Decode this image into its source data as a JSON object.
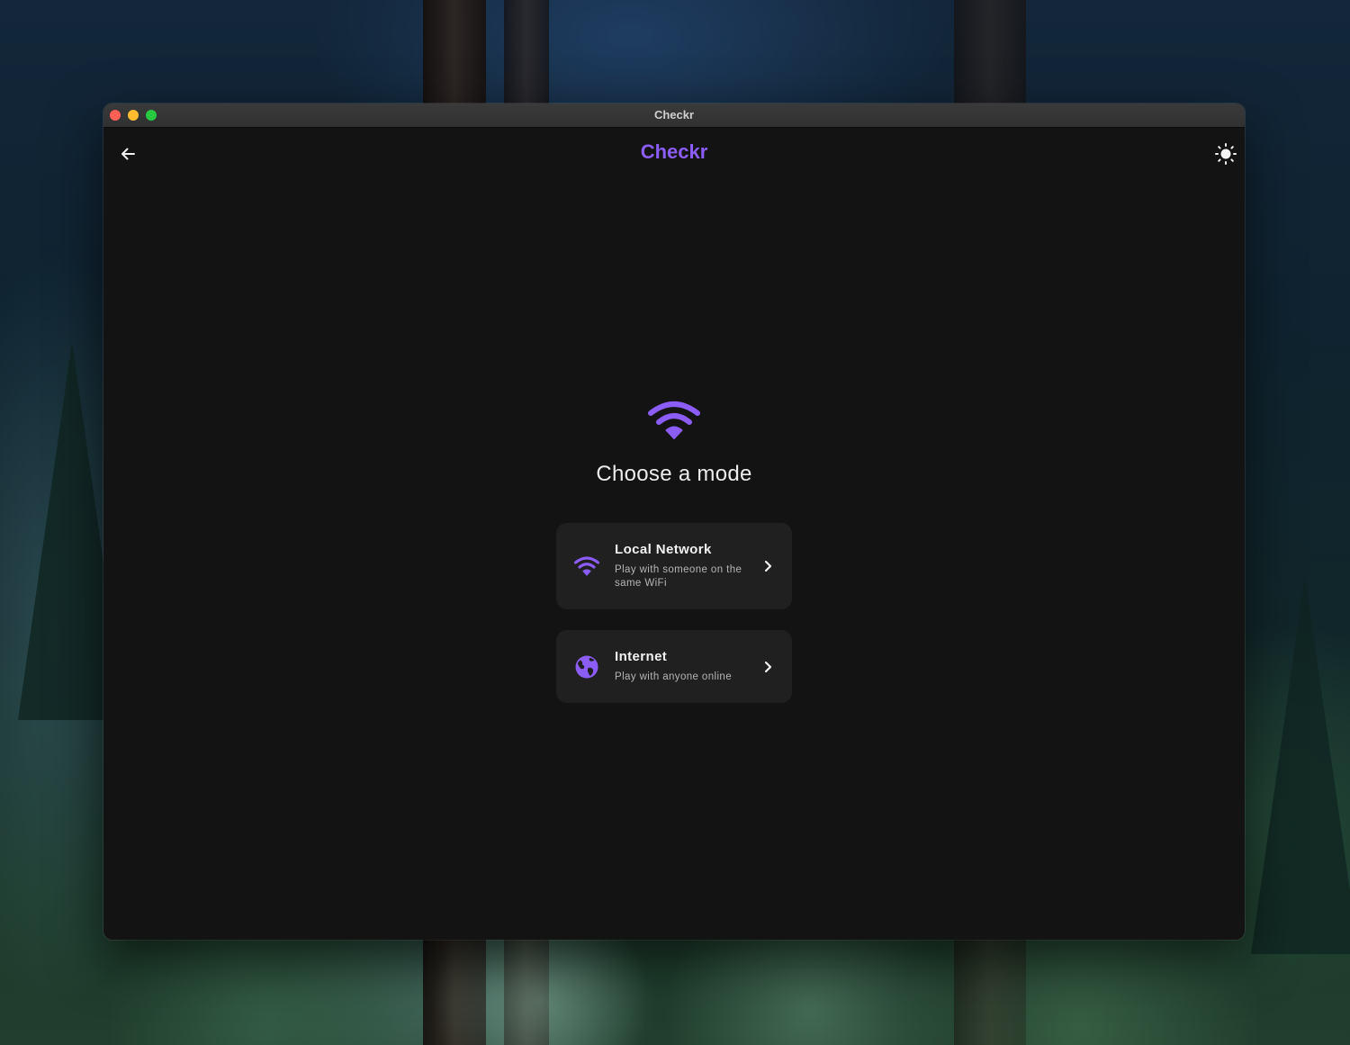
{
  "window": {
    "title": "Checkr"
  },
  "appbar": {
    "title": "Checkr",
    "back_icon": "arrow-left-icon",
    "theme_icon": "sun-icon"
  },
  "main": {
    "hero_icon": "wifi-icon",
    "heading": "Choose a mode",
    "options": [
      {
        "icon": "wifi-icon",
        "title": "Local Network",
        "subtitle": "Play with someone on the same WiFi"
      },
      {
        "icon": "globe-icon",
        "title": "Internet",
        "subtitle": "Play with anyone online"
      }
    ]
  },
  "colors": {
    "accent": "#8b5cf6",
    "background": "#131313",
    "card": "#202020",
    "text": "#ececec",
    "muted_text": "#b5b5b5"
  }
}
